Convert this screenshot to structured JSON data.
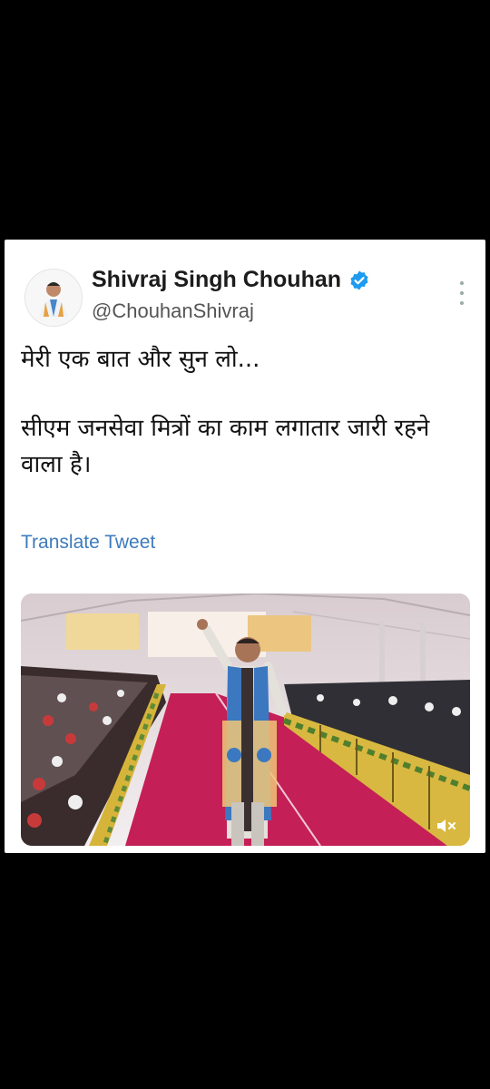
{
  "tweet": {
    "author_name": "Shivraj Singh Chouhan",
    "author_handle": "@ChouhanShivraj",
    "line1": "मेरी एक बात और सुन लो...",
    "line2": "सीएम जनसेवा मित्रों का काम लगातार जारी रहने वाला है।",
    "translate_label": "Translate Tweet"
  },
  "icons": {
    "verified": "verified-badge-icon",
    "more": "more-vertical-icon",
    "mute": "volume-mute-icon"
  },
  "colors": {
    "background": "#000000",
    "card": "#ffffff",
    "link": "#3d7bbd",
    "verified": "#1d9bf0",
    "carpet": "#c41f57"
  }
}
